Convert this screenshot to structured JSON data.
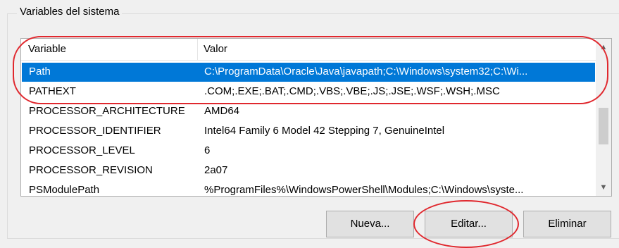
{
  "group": {
    "title": "Variables del sistema"
  },
  "table": {
    "columns": [
      "Variable",
      "Valor"
    ],
    "rows": [
      {
        "variable": "Path",
        "valor": "C:\\ProgramData\\Oracle\\Java\\javapath;C:\\Windows\\system32;C:\\Wi...",
        "selected": true
      },
      {
        "variable": "PATHEXT",
        "valor": ".COM;.EXE;.BAT;.CMD;.VBS;.VBE;.JS;.JSE;.WSF;.WSH;.MSC"
      },
      {
        "variable": "PROCESSOR_ARCHITECTURE",
        "valor": "AMD64"
      },
      {
        "variable": "PROCESSOR_IDENTIFIER",
        "valor": "Intel64 Family 6 Model 42 Stepping 7, GenuineIntel"
      },
      {
        "variable": "PROCESSOR_LEVEL",
        "valor": "6"
      },
      {
        "variable": "PROCESSOR_REVISION",
        "valor": "2a07"
      },
      {
        "variable": "PSModulePath",
        "valor": "%ProgramFiles%\\WindowsPowerShell\\Modules;C:\\Windows\\syste..."
      }
    ]
  },
  "buttons": {
    "new": "Nueva...",
    "edit": "Editar...",
    "delete": "Eliminar"
  },
  "colors": {
    "selection": "#0078d7",
    "annotation": "#e0282e"
  }
}
